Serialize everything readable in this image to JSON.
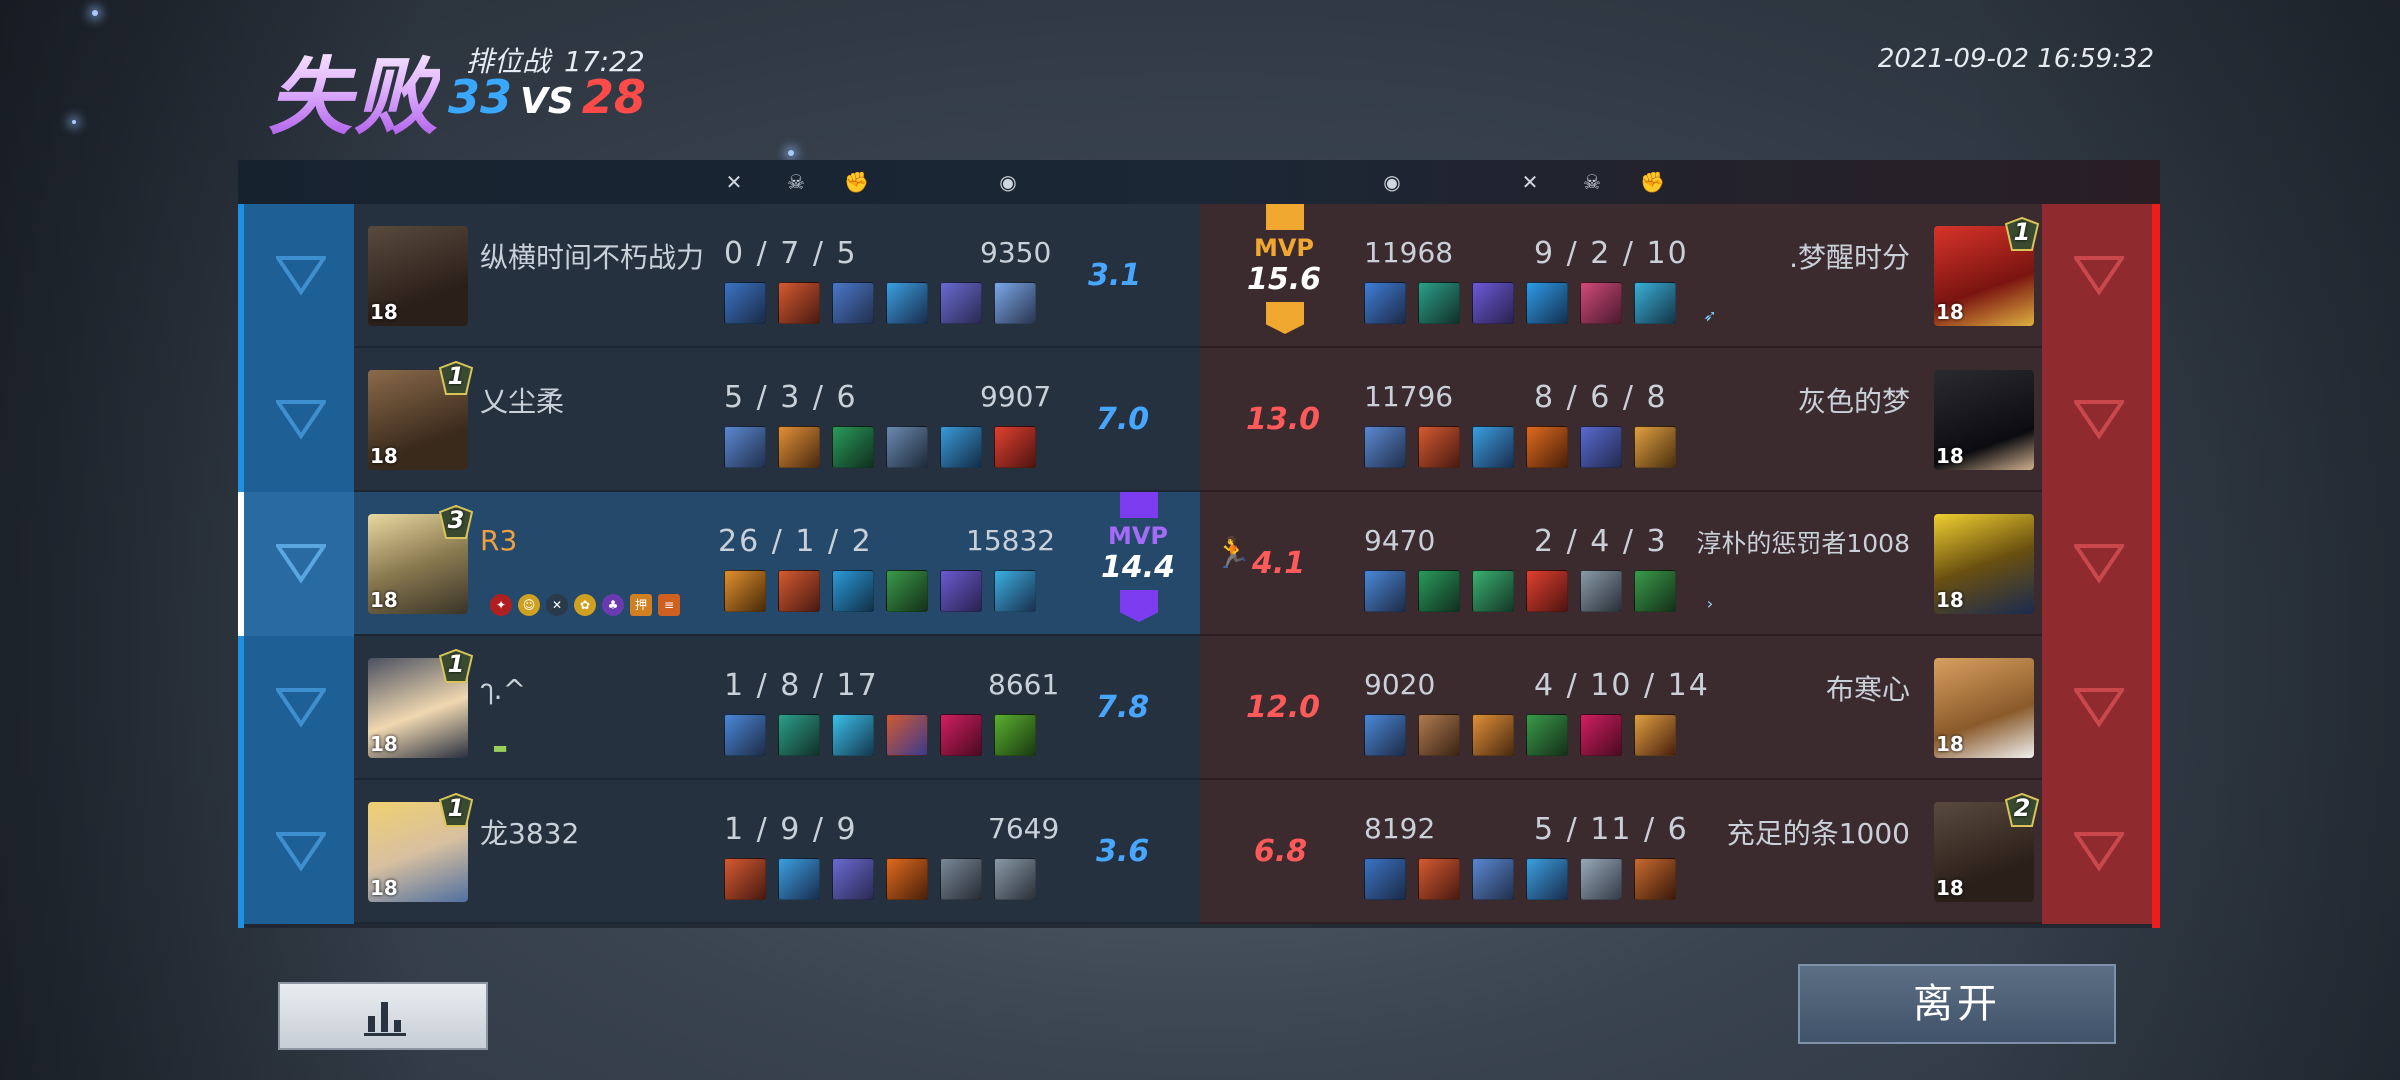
{
  "header": {
    "result": "失败",
    "mode": "排位战",
    "duration": "17:22",
    "score_blue": "33",
    "score_vs": "VS",
    "score_red": "28",
    "datetime": "2021-09-02 16:59:32"
  },
  "colors": {
    "blue": "#3aa8ff",
    "red": "#ff4a4a",
    "mvp_gold": "#f0a830",
    "mvp_purple": "#7e3cf0"
  },
  "table_header_icons": {
    "left": [
      "swords-icon",
      "skull-icon",
      "assist-fist-icon",
      "coin-icon"
    ],
    "right": [
      "coin-icon",
      "swords-icon",
      "skull-icon",
      "assist-fist-icon"
    ]
  },
  "blue_team": [
    {
      "name": "纵横时间不朽战力",
      "level": "18",
      "rank": "",
      "kda": "0 / 7 / 5",
      "gold": "9350",
      "rating": "3.1"
    },
    {
      "name": "乂尘柔",
      "level": "18",
      "rank": "1",
      "kda": "5 / 3 / 6",
      "gold": "9907",
      "rating": "7.0"
    },
    {
      "name": "R3",
      "level": "18",
      "rank": "3",
      "kda": "26 / 1 / 2",
      "gold": "15832",
      "rating": "",
      "mvp_label": "MVP",
      "mvp_score": "14.4"
    },
    {
      "name": "ๅ.^",
      "level": "18",
      "rank": "1",
      "kda": "1 / 8 / 17",
      "gold": "8661",
      "rating": "7.8"
    },
    {
      "name": "龙3832",
      "level": "18",
      "rank": "1",
      "kda": "1 / 9 / 9",
      "gold": "7649",
      "rating": "3.6"
    }
  ],
  "red_team": [
    {
      "name": ".梦醒时分",
      "level": "18",
      "rank": "1",
      "kda": "9 / 2 / 10",
      "gold": "11968",
      "rating": "",
      "mvp_label": "MVP",
      "mvp_score": "15.6"
    },
    {
      "name": "灰色的梦",
      "level": "18",
      "rank": "",
      "kda": "8 / 6 / 8",
      "gold": "11796",
      "rating": "13.0"
    },
    {
      "name": "淳朴的惩罚者1008",
      "level": "18",
      "rank": "",
      "kda": "2 / 4 / 3",
      "gold": "9470",
      "rating": "4.1"
    },
    {
      "name": "布寒心",
      "level": "18",
      "rank": "",
      "kda": "4 / 10 / 14",
      "gold": "9020",
      "rating": "12.0"
    },
    {
      "name": "充足的条1000",
      "level": "18",
      "rank": "2",
      "kda": "5 / 11 / 6",
      "gold": "8192",
      "rating": "6.8"
    }
  ],
  "buttons": {
    "leave": "离开",
    "stats": "stats-chart-icon"
  }
}
